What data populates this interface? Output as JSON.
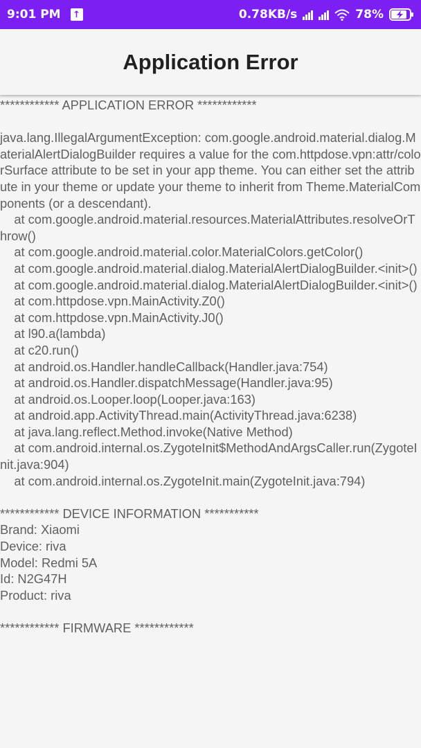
{
  "status_bar": {
    "time": "9:01 PM",
    "network_speed": "0.78KB/s",
    "battery_percent": "78%",
    "icons": [
      "upload-icon",
      "signal-icon",
      "signal-icon",
      "wifi-icon",
      "battery-charging-icon"
    ]
  },
  "app_bar": {
    "title": "Application Error"
  },
  "report": {
    "text": "************ APPLICATION ERROR ************\n\njava.lang.IllegalArgumentException: com.google.android.material.dialog.MaterialAlertDialogBuilder requires a value for the com.httpdose.vpn:attr/colorSurface attribute to be set in your app theme. You can either set the attribute in your theme or update your theme to inherit from Theme.MaterialComponents (or a descendant).\n    at com.google.android.material.resources.MaterialAttributes.resolveOrThrow()\n    at com.google.android.material.color.MaterialColors.getColor()\n    at com.google.android.material.dialog.MaterialAlertDialogBuilder.<init>()\n    at com.google.android.material.dialog.MaterialAlertDialogBuilder.<init>()\n    at com.httpdose.vpn.MainActivity.Z0()\n    at com.httpdose.vpn.MainActivity.J0()\n    at l90.a(lambda)\n    at c20.run()\n    at android.os.Handler.handleCallback(Handler.java:754)\n    at android.os.Handler.dispatchMessage(Handler.java:95)\n    at android.os.Looper.loop(Looper.java:163)\n    at android.app.ActivityThread.main(ActivityThread.java:6238)\n    at java.lang.reflect.Method.invoke(Native Method)\n    at com.android.internal.os.ZygoteInit$MethodAndArgsCaller.run(ZygoteInit.java:904)\n    at com.android.internal.os.ZygoteInit.main(ZygoteInit.java:794)\n\n************ DEVICE INFORMATION ***********\nBrand: Xiaomi\nDevice: riva\nModel: Redmi 5A\nId: N2G47H\nProduct: riva\n\n************ FIRMWARE ************"
  },
  "colors": {
    "status_bar_bg": "#7b1ff2",
    "page_bg": "#f5f5f5",
    "title_text": "#212121",
    "body_text": "#5f5f5f"
  }
}
